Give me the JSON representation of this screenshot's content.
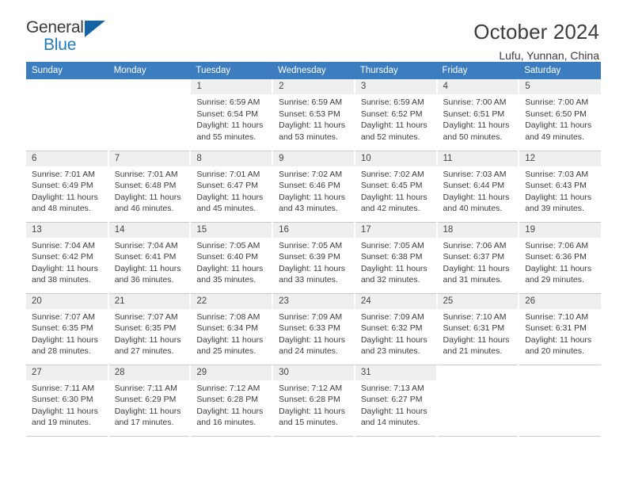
{
  "brand": {
    "name_top": "General",
    "name_bottom": "Blue",
    "triangle_color": "#1464a5",
    "blue_text_color": "#1f7ac0"
  },
  "header": {
    "title": "October 2024",
    "subtitle": "Lufu, Yunnan, China",
    "header_bg": "#3b7dbf",
    "header_text_color": "#ffffff"
  },
  "weekdays": [
    "Sunday",
    "Monday",
    "Tuesday",
    "Wednesday",
    "Thursday",
    "Friday",
    "Saturday"
  ],
  "labels": {
    "sunrise_prefix": "Sunrise:",
    "sunset_prefix": "Sunset:",
    "daylight_prefix": "Daylight:"
  },
  "weeks": [
    [
      {
        "day": "",
        "sunrise": "",
        "sunset": "",
        "daylight_line1": "",
        "daylight_line2": "",
        "empty": true,
        "blank": true
      },
      {
        "day": "",
        "sunrise": "",
        "sunset": "",
        "daylight_line1": "",
        "daylight_line2": "",
        "empty": true,
        "blank": true
      },
      {
        "day": "1",
        "sunrise": "Sunrise: 6:59 AM",
        "sunset": "Sunset: 6:54 PM",
        "daylight_line1": "Daylight: 11 hours",
        "daylight_line2": "and 55 minutes."
      },
      {
        "day": "2",
        "sunrise": "Sunrise: 6:59 AM",
        "sunset": "Sunset: 6:53 PM",
        "daylight_line1": "Daylight: 11 hours",
        "daylight_line2": "and 53 minutes."
      },
      {
        "day": "3",
        "sunrise": "Sunrise: 6:59 AM",
        "sunset": "Sunset: 6:52 PM",
        "daylight_line1": "Daylight: 11 hours",
        "daylight_line2": "and 52 minutes."
      },
      {
        "day": "4",
        "sunrise": "Sunrise: 7:00 AM",
        "sunset": "Sunset: 6:51 PM",
        "daylight_line1": "Daylight: 11 hours",
        "daylight_line2": "and 50 minutes."
      },
      {
        "day": "5",
        "sunrise": "Sunrise: 7:00 AM",
        "sunset": "Sunset: 6:50 PM",
        "daylight_line1": "Daylight: 11 hours",
        "daylight_line2": "and 49 minutes."
      }
    ],
    [
      {
        "day": "6",
        "sunrise": "Sunrise: 7:01 AM",
        "sunset": "Sunset: 6:49 PM",
        "daylight_line1": "Daylight: 11 hours",
        "daylight_line2": "and 48 minutes."
      },
      {
        "day": "7",
        "sunrise": "Sunrise: 7:01 AM",
        "sunset": "Sunset: 6:48 PM",
        "daylight_line1": "Daylight: 11 hours",
        "daylight_line2": "and 46 minutes."
      },
      {
        "day": "8",
        "sunrise": "Sunrise: 7:01 AM",
        "sunset": "Sunset: 6:47 PM",
        "daylight_line1": "Daylight: 11 hours",
        "daylight_line2": "and 45 minutes."
      },
      {
        "day": "9",
        "sunrise": "Sunrise: 7:02 AM",
        "sunset": "Sunset: 6:46 PM",
        "daylight_line1": "Daylight: 11 hours",
        "daylight_line2": "and 43 minutes."
      },
      {
        "day": "10",
        "sunrise": "Sunrise: 7:02 AM",
        "sunset": "Sunset: 6:45 PM",
        "daylight_line1": "Daylight: 11 hours",
        "daylight_line2": "and 42 minutes."
      },
      {
        "day": "11",
        "sunrise": "Sunrise: 7:03 AM",
        "sunset": "Sunset: 6:44 PM",
        "daylight_line1": "Daylight: 11 hours",
        "daylight_line2": "and 40 minutes."
      },
      {
        "day": "12",
        "sunrise": "Sunrise: 7:03 AM",
        "sunset": "Sunset: 6:43 PM",
        "daylight_line1": "Daylight: 11 hours",
        "daylight_line2": "and 39 minutes."
      }
    ],
    [
      {
        "day": "13",
        "sunrise": "Sunrise: 7:04 AM",
        "sunset": "Sunset: 6:42 PM",
        "daylight_line1": "Daylight: 11 hours",
        "daylight_line2": "and 38 minutes."
      },
      {
        "day": "14",
        "sunrise": "Sunrise: 7:04 AM",
        "sunset": "Sunset: 6:41 PM",
        "daylight_line1": "Daylight: 11 hours",
        "daylight_line2": "and 36 minutes."
      },
      {
        "day": "15",
        "sunrise": "Sunrise: 7:05 AM",
        "sunset": "Sunset: 6:40 PM",
        "daylight_line1": "Daylight: 11 hours",
        "daylight_line2": "and 35 minutes."
      },
      {
        "day": "16",
        "sunrise": "Sunrise: 7:05 AM",
        "sunset": "Sunset: 6:39 PM",
        "daylight_line1": "Daylight: 11 hours",
        "daylight_line2": "and 33 minutes."
      },
      {
        "day": "17",
        "sunrise": "Sunrise: 7:05 AM",
        "sunset": "Sunset: 6:38 PM",
        "daylight_line1": "Daylight: 11 hours",
        "daylight_line2": "and 32 minutes."
      },
      {
        "day": "18",
        "sunrise": "Sunrise: 7:06 AM",
        "sunset": "Sunset: 6:37 PM",
        "daylight_line1": "Daylight: 11 hours",
        "daylight_line2": "and 31 minutes."
      },
      {
        "day": "19",
        "sunrise": "Sunrise: 7:06 AM",
        "sunset": "Sunset: 6:36 PM",
        "daylight_line1": "Daylight: 11 hours",
        "daylight_line2": "and 29 minutes."
      }
    ],
    [
      {
        "day": "20",
        "sunrise": "Sunrise: 7:07 AM",
        "sunset": "Sunset: 6:35 PM",
        "daylight_line1": "Daylight: 11 hours",
        "daylight_line2": "and 28 minutes."
      },
      {
        "day": "21",
        "sunrise": "Sunrise: 7:07 AM",
        "sunset": "Sunset: 6:35 PM",
        "daylight_line1": "Daylight: 11 hours",
        "daylight_line2": "and 27 minutes."
      },
      {
        "day": "22",
        "sunrise": "Sunrise: 7:08 AM",
        "sunset": "Sunset: 6:34 PM",
        "daylight_line1": "Daylight: 11 hours",
        "daylight_line2": "and 25 minutes."
      },
      {
        "day": "23",
        "sunrise": "Sunrise: 7:09 AM",
        "sunset": "Sunset: 6:33 PM",
        "daylight_line1": "Daylight: 11 hours",
        "daylight_line2": "and 24 minutes."
      },
      {
        "day": "24",
        "sunrise": "Sunrise: 7:09 AM",
        "sunset": "Sunset: 6:32 PM",
        "daylight_line1": "Daylight: 11 hours",
        "daylight_line2": "and 23 minutes."
      },
      {
        "day": "25",
        "sunrise": "Sunrise: 7:10 AM",
        "sunset": "Sunset: 6:31 PM",
        "daylight_line1": "Daylight: 11 hours",
        "daylight_line2": "and 21 minutes."
      },
      {
        "day": "26",
        "sunrise": "Sunrise: 7:10 AM",
        "sunset": "Sunset: 6:31 PM",
        "daylight_line1": "Daylight: 11 hours",
        "daylight_line2": "and 20 minutes."
      }
    ],
    [
      {
        "day": "27",
        "sunrise": "Sunrise: 7:11 AM",
        "sunset": "Sunset: 6:30 PM",
        "daylight_line1": "Daylight: 11 hours",
        "daylight_line2": "and 19 minutes."
      },
      {
        "day": "28",
        "sunrise": "Sunrise: 7:11 AM",
        "sunset": "Sunset: 6:29 PM",
        "daylight_line1": "Daylight: 11 hours",
        "daylight_line2": "and 17 minutes."
      },
      {
        "day": "29",
        "sunrise": "Sunrise: 7:12 AM",
        "sunset": "Sunset: 6:28 PM",
        "daylight_line1": "Daylight: 11 hours",
        "daylight_line2": "and 16 minutes."
      },
      {
        "day": "30",
        "sunrise": "Sunrise: 7:12 AM",
        "sunset": "Sunset: 6:28 PM",
        "daylight_line1": "Daylight: 11 hours",
        "daylight_line2": "and 15 minutes."
      },
      {
        "day": "31",
        "sunrise": "Sunrise: 7:13 AM",
        "sunset": "Sunset: 6:27 PM",
        "daylight_line1": "Daylight: 11 hours",
        "daylight_line2": "and 14 minutes."
      },
      {
        "day": "",
        "sunrise": "",
        "sunset": "",
        "daylight_line1": "",
        "daylight_line2": "",
        "empty": true,
        "blank": true
      },
      {
        "day": "",
        "sunrise": "",
        "sunset": "",
        "daylight_line1": "",
        "daylight_line2": "",
        "empty": true,
        "blank": true
      }
    ]
  ]
}
